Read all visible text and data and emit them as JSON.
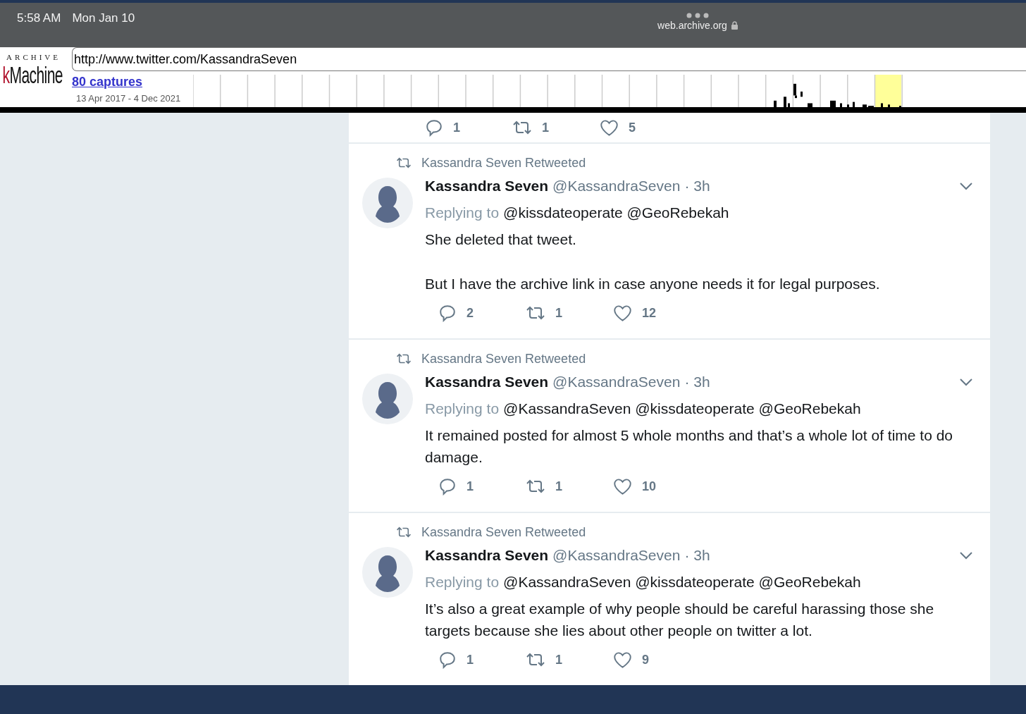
{
  "status_bar": {
    "time": "5:58 AM",
    "date": "Mon Jan 10",
    "domain": "web.archive.org"
  },
  "wayback": {
    "logo_top": "ARCHIVE",
    "logo_cut": "k",
    "logo_main": "Machine",
    "url": "http://www.twitter.com/KassandraSeven",
    "captures": "80 captures",
    "range": "13 Apr 2017 - 4 Dec 2021"
  },
  "partial_tweet": {
    "replies": "1",
    "retweets": "1",
    "likes": "5"
  },
  "tweets": [
    {
      "context": "Kassandra Seven Retweeted",
      "name": "Kassandra Seven",
      "handle": "@KassandraSeven",
      "time": "· 3h",
      "replying_label": "Replying to",
      "replying_to": "@kissdateoperate @GeoRebekah",
      "paragraphs": [
        "She deleted that tweet.",
        "But I have the archive link in case anyone needs it for legal purposes."
      ],
      "replies": "2",
      "retweets": "1",
      "likes": "12"
    },
    {
      "context": "Kassandra Seven Retweeted",
      "name": "Kassandra Seven",
      "handle": "@KassandraSeven",
      "time": "· 3h",
      "replying_label": "Replying to",
      "replying_to": "@KassandraSeven @kissdateoperate @GeoRebekah",
      "paragraphs": [
        "It remained posted for almost 5 whole months and that’s a whole lot of time to do damage."
      ],
      "replies": "1",
      "retweets": "1",
      "likes": "10"
    },
    {
      "context": "Kassandra Seven Retweeted",
      "name": "Kassandra Seven",
      "handle": "@KassandraSeven",
      "time": "· 3h",
      "replying_label": "Replying to",
      "replying_to": "@KassandraSeven @kissdateoperate @GeoRebekah",
      "paragraphs": [
        "It’s also a great example of why people should be careful harassing those she targets because she lies about other people on twitter a lot."
      ],
      "replies": "1",
      "retweets": "1",
      "likes": "9"
    }
  ]
}
